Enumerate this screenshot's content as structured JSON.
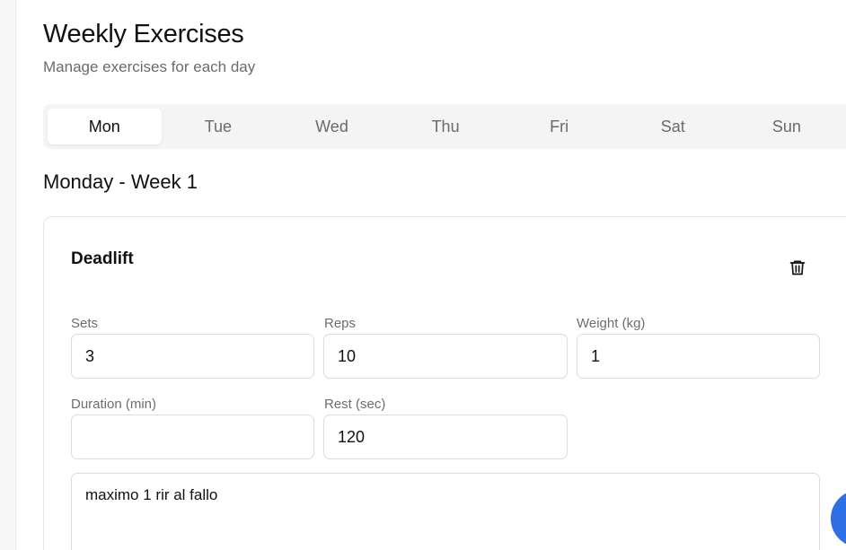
{
  "header": {
    "title": "Weekly Exercises",
    "subtitle": "Manage exercises for each day"
  },
  "tabs": [
    {
      "label": "Mon",
      "active": true
    },
    {
      "label": "Tue",
      "active": false
    },
    {
      "label": "Wed",
      "active": false
    },
    {
      "label": "Thu",
      "active": false
    },
    {
      "label": "Fri",
      "active": false
    },
    {
      "label": "Sat",
      "active": false
    },
    {
      "label": "Sun",
      "active": false
    }
  ],
  "day_heading": "Monday - Week 1",
  "exercise": {
    "name": "Deadlift",
    "delete_icon": "trash-icon",
    "fields": {
      "sets": {
        "label": "Sets",
        "value": "3"
      },
      "reps": {
        "label": "Reps",
        "value": "10"
      },
      "weight": {
        "label": "Weight (kg)",
        "value": "1"
      },
      "duration": {
        "label": "Duration (min)",
        "value": ""
      },
      "rest": {
        "label": "Rest (sec)",
        "value": "120"
      }
    },
    "notes": "maximo 1 rir al fallo"
  },
  "colors": {
    "accent": "#2f6fe6",
    "tab_bar_bg": "#f4f4f4",
    "border": "#dcdcdc"
  }
}
